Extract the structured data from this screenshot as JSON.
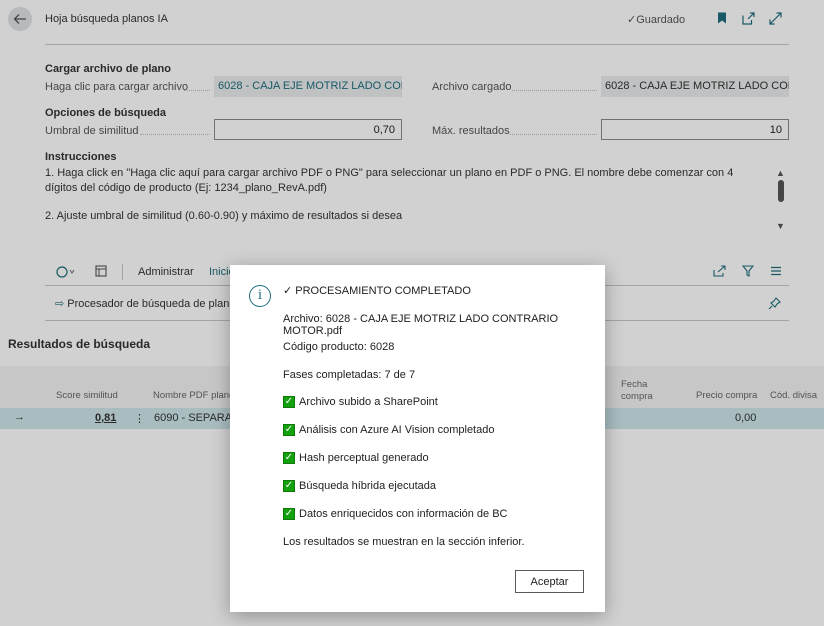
{
  "header": {
    "title": "Hoja búsqueda planos IA",
    "saved_label": "Guardado"
  },
  "upload_section": {
    "title": "Cargar archivo de plano",
    "click_label": "Haga clic para cargar archivo",
    "click_value": "6028 - CAJA EJE MOTRIZ LADO CON...",
    "loaded_label": "Archivo cargado",
    "loaded_value": "6028 - CAJA EJE MOTRIZ LADO CON..."
  },
  "search_options": {
    "title": "Opciones de búsqueda",
    "threshold_label": "Umbral de similitud",
    "threshold_value": "0,70",
    "max_label": "Máx. resultados",
    "max_value": "10"
  },
  "instructions": {
    "title": "Instrucciones",
    "line1": "1. Haga click en \"Haga clic aquí para cargar archivo PDF o PNG\" para seleccionar un plano en PDF o PNG. El nombre debe comenzar con 4 dígitos del código de producto (Ej: 1234_plano_RevA.pdf)",
    "line2": "2. Ajuste umbral de similitud (0.60-0.90) y máximo de resultados si desea"
  },
  "actionbar": {
    "admin_label": "Administrar",
    "inicio_label": "Inicio",
    "processor_label": "Procesador de búsqueda de plano"
  },
  "results": {
    "title": "Resultados de búsqueda",
    "columns": {
      "score": "Score similitud",
      "pdf_name": "Nombre PDF plano",
      "fecha": "Fecha compra",
      "precio": "Precio compra",
      "divisa": "Cód. divisa"
    },
    "rows": [
      {
        "score": "0,81",
        "pdf_name": "6090 - SEPARAD",
        "precio": "0,00"
      }
    ]
  },
  "dialog": {
    "heading": "✓ PROCESAMIENTO COMPLETADO",
    "archivo": "Archivo: 6028 - CAJA EJE MOTRIZ LADO CONTRARIO MOTOR.pdf",
    "codigo": "Código producto: 6028",
    "fases": "Fases completadas: 7 de 7",
    "checks": [
      "Archivo subido a SharePoint",
      "Análisis con Azure AI Vision completado",
      "Hash perceptual generado",
      "Búsqueda híbrida ejecutada",
      "Datos enriquecidos con información de BC"
    ],
    "footer": "Los resultados se muestran en la sección inferior.",
    "accept_label": "Aceptar"
  },
  "colors": {
    "accent": "#1e6d7c",
    "check_green": "#13a10e",
    "selected_row": "#cfe7ec"
  }
}
